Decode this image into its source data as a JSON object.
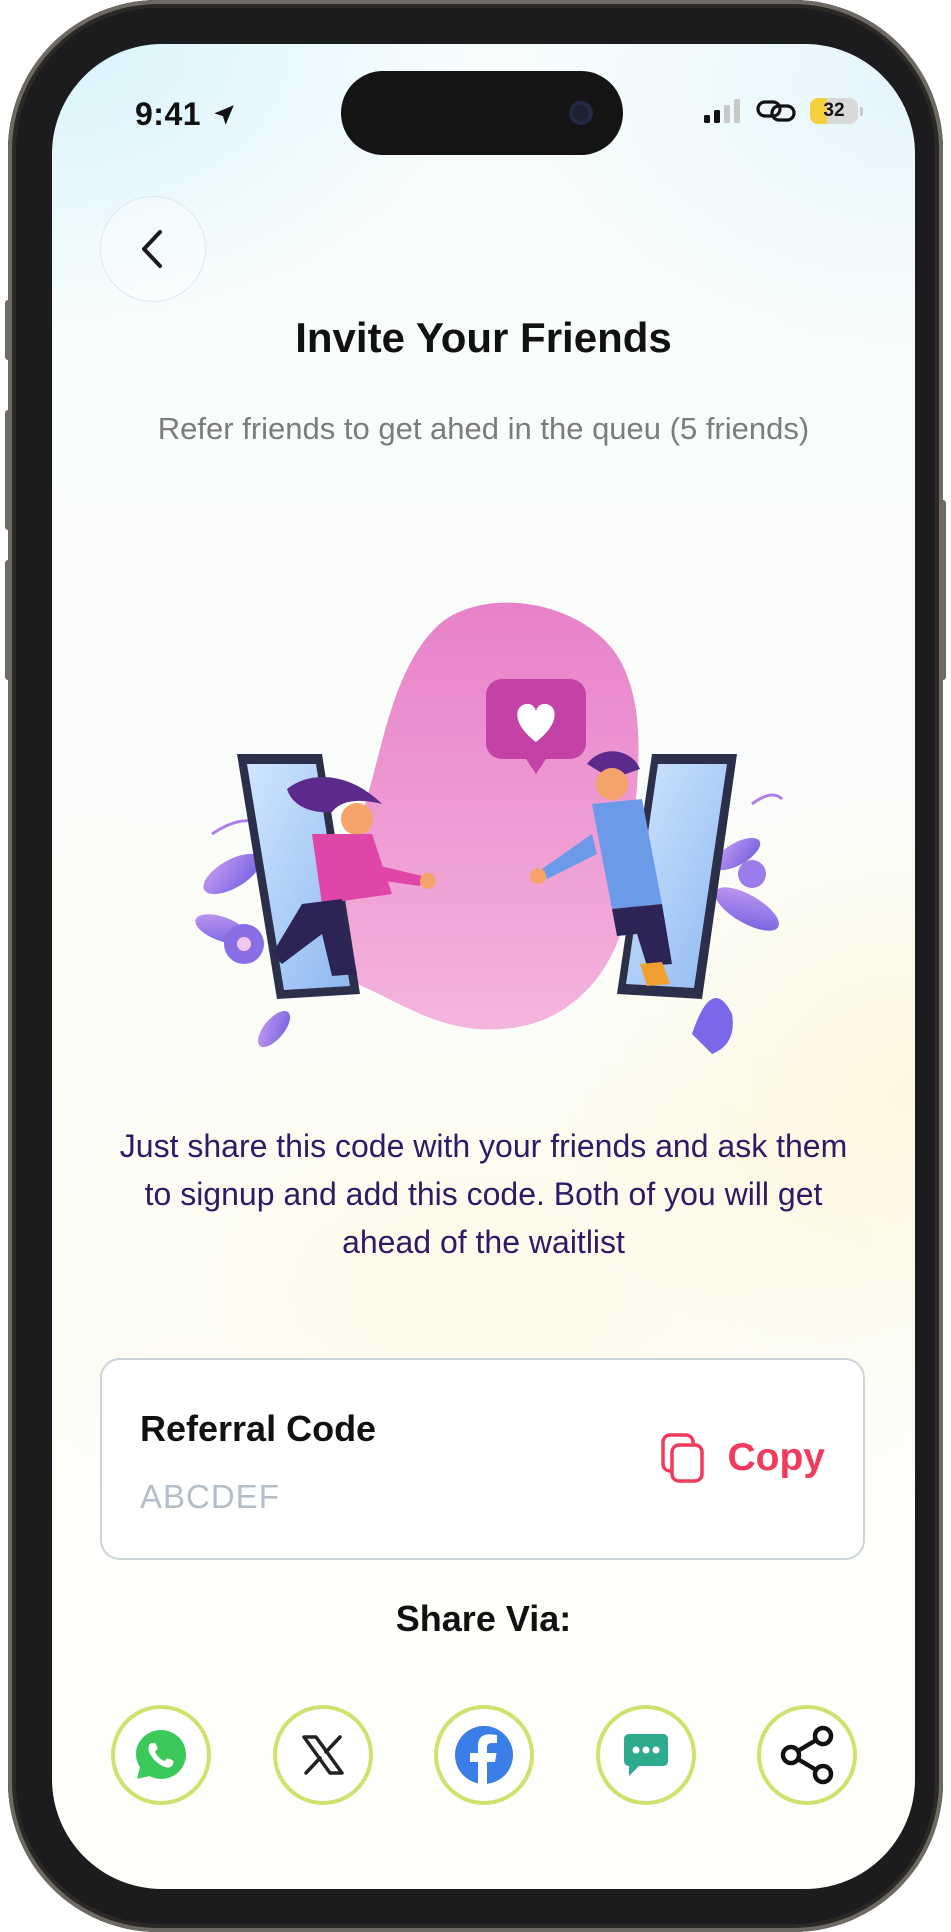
{
  "status_bar": {
    "time": "9:41",
    "battery_level": "32"
  },
  "header": {
    "title": "Invite Your Friends",
    "subtitle": "Refer friends to get ahed in the queu (5 friends)"
  },
  "description": "Just share this code with your friends and ask them to signup and add this code. Both of you will get ahead of the waitlist",
  "referral": {
    "label": "Referral Code",
    "code": "ABCDEF",
    "copy_label": "Copy"
  },
  "share": {
    "title": "Share Via:",
    "options": [
      "whatsapp",
      "x",
      "facebook",
      "messages",
      "share"
    ]
  },
  "colors": {
    "accent": "#f13a5c",
    "share_ring": "#cde36e",
    "description_text": "#2e1a66",
    "whatsapp": "#3cc95b",
    "facebook": "#3a7ee8",
    "messages": "#2eab8f"
  }
}
